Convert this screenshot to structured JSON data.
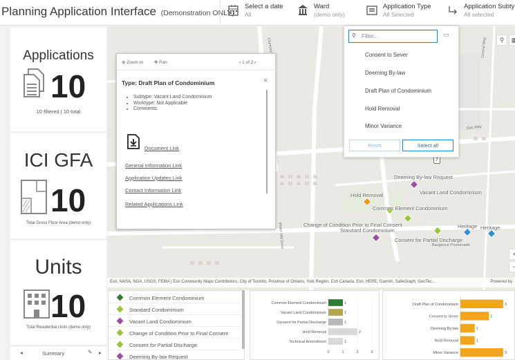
{
  "header": {
    "title": "Planning Application Interface",
    "title_note": "(Demonstration ONLY)",
    "filters": [
      {
        "label": "Select a date",
        "value": "All"
      },
      {
        "label": "Ward",
        "value": "(demo only)"
      },
      {
        "label": "Application Type",
        "value": "All Selected"
      },
      {
        "label": "Application Subtype",
        "value": "All selected"
      }
    ]
  },
  "cards": {
    "applications": {
      "title": "Applications",
      "value": "10",
      "caption": "10 filtered | 10 total"
    },
    "ici_gfa": {
      "title": "ICI GFA",
      "value": "10",
      "caption": "Total Gross Floor Area (demo only)"
    },
    "units": {
      "title": "Units",
      "value": "10",
      "caption": "Total Residential Units (demo only)"
    }
  },
  "summary_nav": {
    "label": "Summary"
  },
  "popup": {
    "zoom_label": "Zoom to",
    "pan_label": "Pan",
    "pager": "1 of 2",
    "title": "Type: Draft Plan of Condominium",
    "details": [
      "Subtype: Vacant Land Condominium",
      "Worktype: Not Applicable",
      "Comments:"
    ],
    "links": {
      "document": "Document Link",
      "general": "General Information Link",
      "updates": "Application Updates Link",
      "contact": "Contact Information Link",
      "related": "Related Applications Link"
    }
  },
  "type_dropdown": {
    "placeholder": "Filter...",
    "options": [
      "Consent to Sever",
      "Deeming By-law",
      "Draft Plan of Condominium",
      "Hold Removal",
      "Minor Variance"
    ],
    "reset_label": "Reset",
    "select_all_label": "Select all"
  },
  "map": {
    "labels": {
      "deeming": "Deeming By-law Request",
      "vacant": "Vacant Land Condominium",
      "hold": "Hold Removal",
      "common": "Common Element Condominium",
      "change": "Change of Condition Prior to Final Consent",
      "standard": "Standard Condominium",
      "partial": "Consent for Partial Discharge",
      "heritage1": "Heritage",
      "heritage2": "Heritage"
    },
    "streets": {
      "street_a": "Chimney Court",
      "street_b": "Elm Way",
      "street_c": "Water Mill Drive",
      "street_d": "Baugence Promenade",
      "street_e": "Central Way"
    },
    "attribution": "Esri, NASA, NGA, USGS, FEMA | Esri Community Maps Contributors, City of Toronto, Province of Ontario, York Region, Esri Canada, Esri, HERE, Garmin, SafeGraph, GeoTec...",
    "powered_by": "Powered by"
  },
  "legend": [
    {
      "label": "Common Element Condominium",
      "color": "#2e7d32"
    },
    {
      "label": "Standard Condominium",
      "color": "#9cc43a"
    },
    {
      "label": "Vacant Land Condominium",
      "color": "#9c4f9e"
    },
    {
      "label": "Change of Condition Prior to Final Consent",
      "color": "#9cc43a"
    },
    {
      "label": "Consent for Partial Discharge",
      "color": "#9cc43a"
    },
    {
      "label": "Deeming By-law Request",
      "color": "#9c4f9e"
    }
  ],
  "chart_data": [
    {
      "type": "bar",
      "orientation": "horizontal",
      "categories": [
        "Common Element Condominium",
        "Vacant Land Condominium",
        "Consent for Partial Discharge",
        "Hold Removal",
        "Technical Amendment"
      ],
      "series": [
        {
          "values": [
            1,
            1,
            1,
            2,
            1
          ],
          "colors": [
            "#2e7d32",
            "#b8a44a",
            "#b8b8b8",
            "#d9d9d9",
            "#d9d9d9"
          ]
        }
      ],
      "value_labels": [
        "1",
        "1",
        "1",
        "2",
        "1"
      ],
      "x_ticks": [
        "0",
        "1",
        "2",
        "3"
      ],
      "xlim": [
        0,
        3
      ]
    },
    {
      "type": "bar",
      "orientation": "horizontal",
      "categories": [
        "Draft Plan of Condominium",
        "Consent to Sever",
        "Deeming By-law",
        "Hold Removal",
        "Minor Variance"
      ],
      "series": [
        {
          "values": [
            3,
            2,
            1,
            1,
            3
          ],
          "color": "#f0a51c"
        }
      ],
      "value_labels": [
        "3",
        "2",
        "1",
        "1",
        "3"
      ],
      "xlim": [
        0,
        3.2
      ]
    }
  ]
}
